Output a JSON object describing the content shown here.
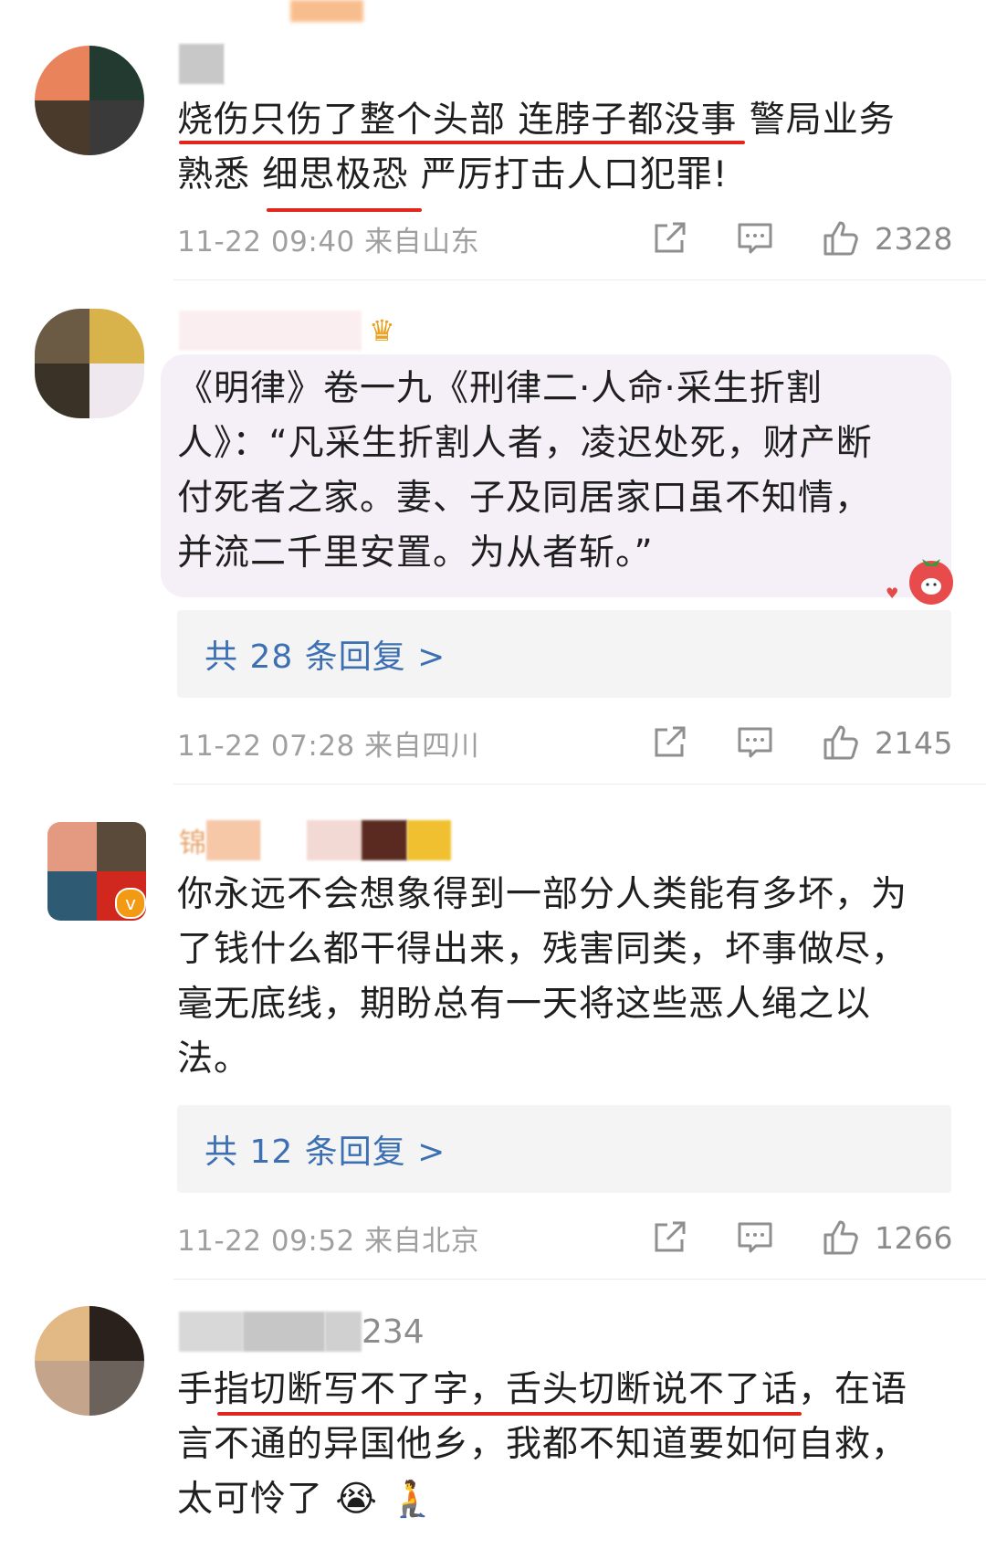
{
  "comments": [
    {
      "username_suffix": "",
      "text_line1": "烧伤只伤了整个头部 连脖子都没事 警局业务",
      "text_line2": "熟悉 细思极恐 严厉打击人口犯罪!",
      "time": "11-22 09:40 来自山东",
      "likes": "2328"
    },
    {
      "text_line1": "《明律》卷一九《刑律二·人命·采生折割",
      "text_line2": "人》：“凡采生折割人者，凌迟处死，财产断",
      "text_line3": "付死者之家。妻、子及同居家口虽不知情，",
      "text_line4": "并流二千里安置。为从者斩。”",
      "replies": "共 28 条回复 >",
      "time": "11-22 07:28 来自四川",
      "likes": "2145"
    },
    {
      "username_prefix": "锦",
      "text_line1": "你永远不会想象得到一部分人类能有多坏，为",
      "text_line2": "了钱什么都干得出来，残害同类，坏事做尽，",
      "text_line3": "毫无底线，期盼总有一天将这些恶人绳之以",
      "text_line4": "法。",
      "replies": "共 12 条回复 >",
      "time": "11-22 09:52 来自北京",
      "likes": "1266"
    },
    {
      "username_suffix": "234",
      "text_line1": "手指切断写不了字，舌头切断说不了话，在语",
      "text_line2": "言不通的异国他乡，我都不知道要如何自救，",
      "text_line3": "太可怜了 😭 🧎"
    }
  ],
  "colors": {
    "link": "#3d6fb3",
    "underline": "#e1271c",
    "meta": "#9f9f9f"
  },
  "icons": [
    "share-icon",
    "comment-icon",
    "like-icon",
    "crown-icon",
    "verified-icon",
    "strawberry-sticker-icon"
  ]
}
